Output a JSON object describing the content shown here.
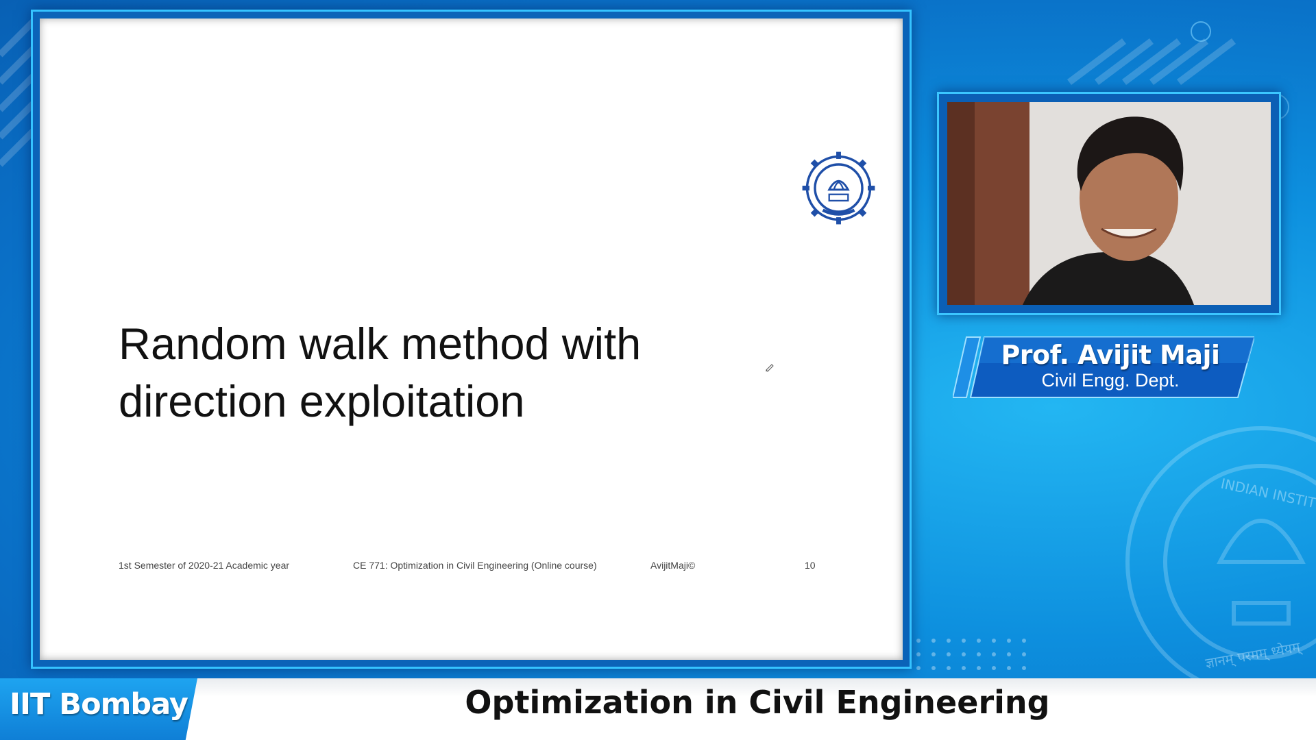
{
  "slide": {
    "title_line1": "Random walk method with",
    "title_line2": "direction exploitation",
    "footer_semester": "1st Semester of 2020-21 Academic year",
    "footer_course": "CE 771: Optimization in Civil Engineering (Online course)",
    "footer_author": "AvijitMaji©",
    "footer_page": "10",
    "logo_icon": "iit-bombay-logo-icon"
  },
  "presenter": {
    "name": "Prof. Avijit Maji",
    "department": "Civil Engg. Dept."
  },
  "bottom_bar": {
    "brand": "IIT Bombay",
    "course_title": "Optimization in Civil Engineering"
  },
  "background": {
    "emblem_text_1": "INDIAN INSTITUTE",
    "emblem_text_2": "ज्ञानम् परमम् ध्येयम्"
  },
  "colors": {
    "accent_blue": "#1ea4f0",
    "frame_blue": "#0b63b8",
    "frame_border": "#35c3ff"
  }
}
